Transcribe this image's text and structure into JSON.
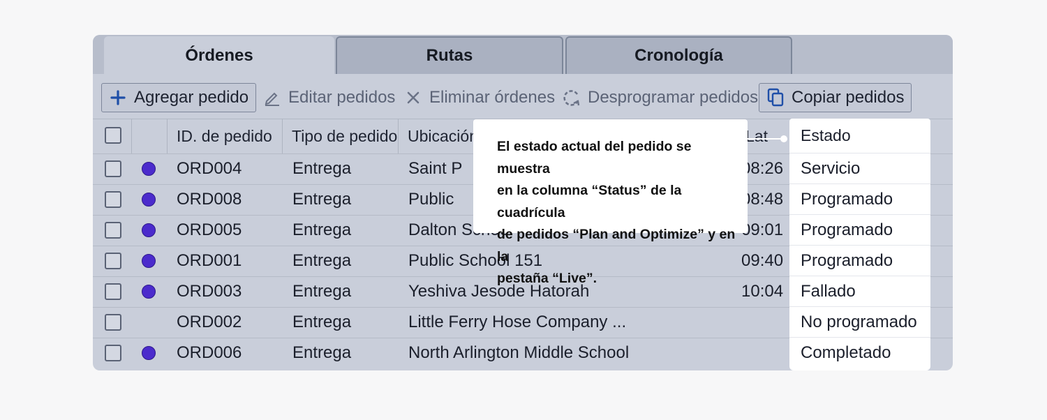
{
  "tabs": [
    {
      "label": "Órdenes",
      "active": true
    },
    {
      "label": "Rutas",
      "active": false
    },
    {
      "label": "Cronología",
      "active": false
    }
  ],
  "toolbar": {
    "add_label": "Agregar pedido",
    "edit_label": "Editar pedidos",
    "delete_label": "Eliminar órdenes",
    "unschedule_label": "Desprogramar pedidos",
    "copy_label": "Copiar pedidos"
  },
  "grid": {
    "columns": {
      "order_id": "ID. de pedido",
      "order_type": "Tipo de pedido",
      "location": "Ubicación",
      "lat": "Lat",
      "status": "Estado"
    },
    "rows": [
      {
        "id": "ORD004",
        "type": "Entrega",
        "location": "Saint P",
        "time": "08:26",
        "status": "Servicio",
        "dot": true
      },
      {
        "id": "ORD008",
        "type": "Entrega",
        "location": "Public",
        "time": "08:48",
        "status": "Programado",
        "dot": true
      },
      {
        "id": "ORD005",
        "type": "Entrega",
        "location": "Dalton School",
        "time": "09:01",
        "status": "Programado",
        "dot": true
      },
      {
        "id": "ORD001",
        "type": "Entrega",
        "location": "Public School 151",
        "time": "09:40",
        "status": "Programado",
        "dot": true
      },
      {
        "id": "ORD003",
        "type": "Entrega",
        "location": "Yeshiva Jesode Hatorah",
        "time": "10:04",
        "status": "Fallado",
        "dot": true
      },
      {
        "id": "ORD002",
        "type": "Entrega",
        "location": "Little Ferry Hose Company ...",
        "time": "",
        "status": "No programado",
        "dot": false
      },
      {
        "id": "ORD006",
        "type": "Entrega",
        "location": "North Arlington Middle School",
        "time": "",
        "status": "Completado",
        "dot": true
      }
    ]
  },
  "tooltip": {
    "lines": [
      "El estado actual del pedido se muestra",
      "en la columna “Status” de la cuadrícula",
      "de pedidos “Plan and Optimize” y en la",
      "pestaña “Live”."
    ]
  },
  "colors": {
    "panel": "#c9ceda",
    "accent": "#1f4fa8",
    "order_dot": "#4b2bcc",
    "tooltip_bg": "#ffffff"
  },
  "icons": {
    "add": "plus-icon",
    "edit": "pencil-icon",
    "delete": "x-icon",
    "unschedule": "rotate-icon",
    "copy": "copy-icon"
  }
}
